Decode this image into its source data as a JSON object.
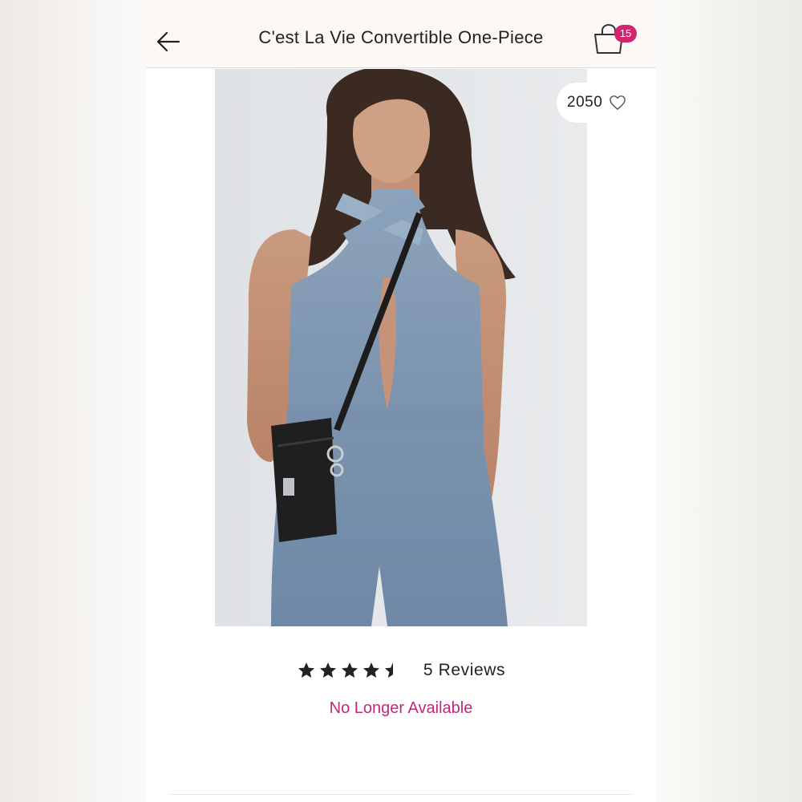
{
  "header": {
    "title": "C'est La Vie Convertible One-Piece",
    "back_icon": "arrow-left-icon",
    "bag_icon": "shopping-bag-icon",
    "bag_count": "15"
  },
  "product": {
    "image_icon": "product-photo",
    "likes": "2050",
    "like_icon": "heart-outline-icon",
    "rating": 4.5,
    "rating_max": 5,
    "reviews_label": "5 Reviews",
    "availability": "No Longer Available"
  },
  "colors": {
    "accent": "#d0256f",
    "availability": "#c2287a",
    "header_bg": "#fbf8f6",
    "text": "#222222"
  }
}
